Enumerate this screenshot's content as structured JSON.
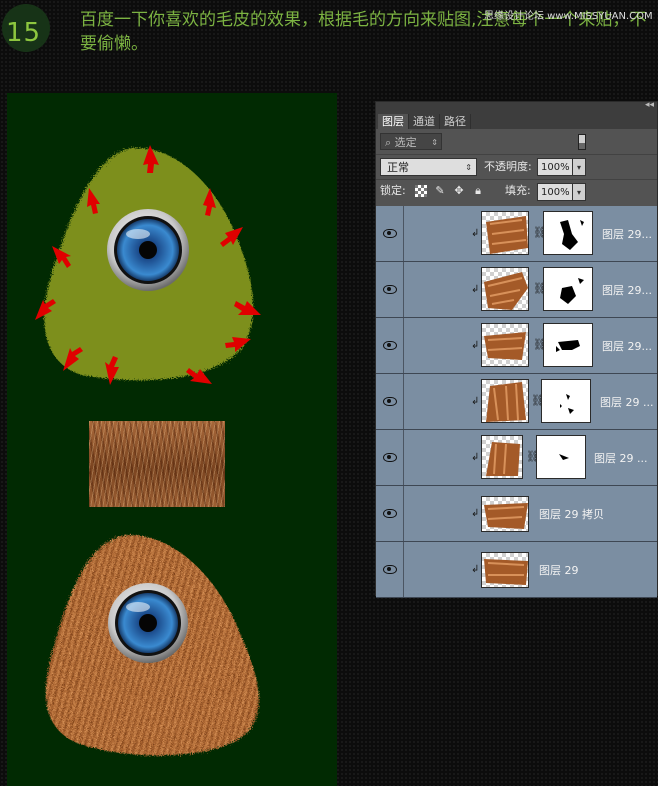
{
  "step": {
    "number": "15",
    "instruction": "百度一下你喜欢的毛皮的效果，根据毛的方向来贴图,注意每个一个来贴，不要偷懒。",
    "watermark": "思缘设计论坛 www.MISSYUAN.COM"
  },
  "colors": {
    "canvas_bg": "#012a02",
    "green_shape": "#7d8f1f",
    "arrow": "#e00000",
    "fur": "#b06a35",
    "eye_iris": "#2b6fb0",
    "panel_bg": "#535353",
    "layer_row": "#7b8ea2",
    "step_text": "#7cb342"
  },
  "panel": {
    "tabs": [
      {
        "label": "图层",
        "active": true
      },
      {
        "label": "通道",
        "active": false
      },
      {
        "label": "路径",
        "active": false
      }
    ],
    "filter_label": "选定",
    "blend_mode": "正常",
    "opacity_label": "不透明度:",
    "opacity_value": "100%",
    "lock_label": "锁定:",
    "fill_label": "填充:",
    "fill_value": "100%",
    "layers": [
      {
        "name": "图层 29...",
        "has_mask": true,
        "visible": true
      },
      {
        "name": "图层 29...",
        "has_mask": true,
        "visible": true
      },
      {
        "name": "图层 29...",
        "has_mask": true,
        "visible": true
      },
      {
        "name": "图层 29 ...",
        "has_mask": true,
        "visible": true
      },
      {
        "name": "图层 29 ...",
        "has_mask": true,
        "visible": true
      },
      {
        "name": "图层 29 拷贝",
        "has_mask": false,
        "visible": true
      },
      {
        "name": "图层 29",
        "has_mask": false,
        "visible": true
      }
    ]
  }
}
